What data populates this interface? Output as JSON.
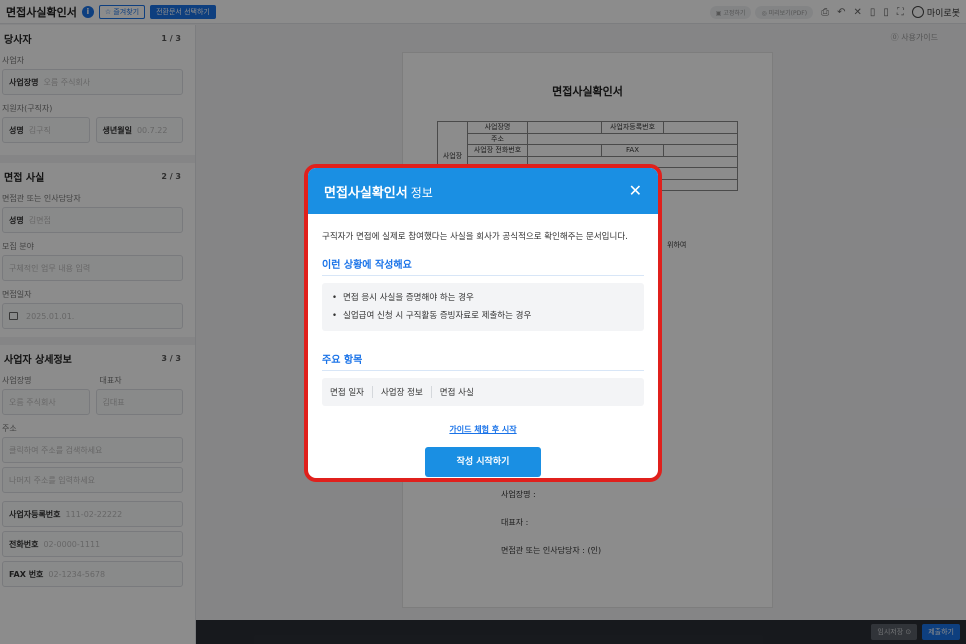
{
  "topbar": {
    "title": "면접사실확인서",
    "info_icon": "i",
    "btn_outline": "☆ 즐겨찾기",
    "btn_fill": "전환문서 선택하기",
    "pill_a": "▣ 고정하기",
    "pill_b": "◎ 미리보기(PDF)",
    "user": "마이로봇"
  },
  "sidebar": {
    "sections": [
      {
        "title": "당사자",
        "count": "1 / 3"
      },
      {
        "title": "면접 사실",
        "count": "2 / 3"
      },
      {
        "title": "사업자 상세정보",
        "count": "3 / 3"
      }
    ],
    "s1": {
      "sub1": "사업자",
      "biz_label": "사업장명",
      "biz_ph": "오름 주식회사",
      "sub2": "지원자(구직자)",
      "name_label": "성명",
      "name_ph": "김구직",
      "birth_label": "생년월일",
      "birth_ph": "00.7.22"
    },
    "s2": {
      "sub1": "면접관 또는 인사담당자",
      "name_label": "성명",
      "name_ph": "김면접",
      "sub2": "모집 분야",
      "field_ph": "구체적인 업무 내용 입력",
      "sub3": "면접일자",
      "date_ph": "2025.01.01."
    },
    "s3": {
      "sub1": "사업장명",
      "sub1b": "대표자",
      "biz_ph": "오름 주식회사",
      "ceo_ph": "김대표",
      "sub2": "주소",
      "addr_ph": "클릭하여 주소를 검색하세요",
      "addr2_ph": "나머지 주소를 입력하세요",
      "reg_label": "사업자등록번호",
      "reg_ph": "111-02-22222",
      "tel_label": "전화번호",
      "tel_ph": "02-0000-1111",
      "fax_label": "FAX 번호",
      "fax_ph": "02-1234-5678"
    }
  },
  "help": "⓪ 사용가이드",
  "paper": {
    "title": "면접사실확인서",
    "rows": {
      "group": "사업장",
      "biz_name": "사업장명",
      "reg_no": "사업자등록번호",
      "address": "주소",
      "tel": "사업장 전화번호",
      "fax": "FAX"
    },
    "frag": "위하여",
    "line_biz": "사업장명 :",
    "line_ceo": "대표자 :",
    "line_hr": "면접관 또는 인사담당자 :     (인)"
  },
  "bottombar": {
    "temp_save": "임시저장 ⊙",
    "submit": "제출하기"
  },
  "modal": {
    "title_bold": "면접사실확인서",
    "title_rest": "정보",
    "close": "✕",
    "description": "구직자가 면접에 실제로 참여했다는 사실을 회사가 공식적으로 확인해주는 문서입니다.",
    "when_title": "이런 상황에 작성해요",
    "cases": [
      "면접 응시 사실을 증명해야 하는 경우",
      "실업급여 신청 시 구직활동 증빙자료로 제출하는 경우"
    ],
    "items_title": "주요 항목",
    "items": [
      "면접 일자",
      "사업장 정보",
      "면접 사실"
    ],
    "guide_link": "가이드 체험 후 시작",
    "start_button": "작성 시작하기"
  }
}
